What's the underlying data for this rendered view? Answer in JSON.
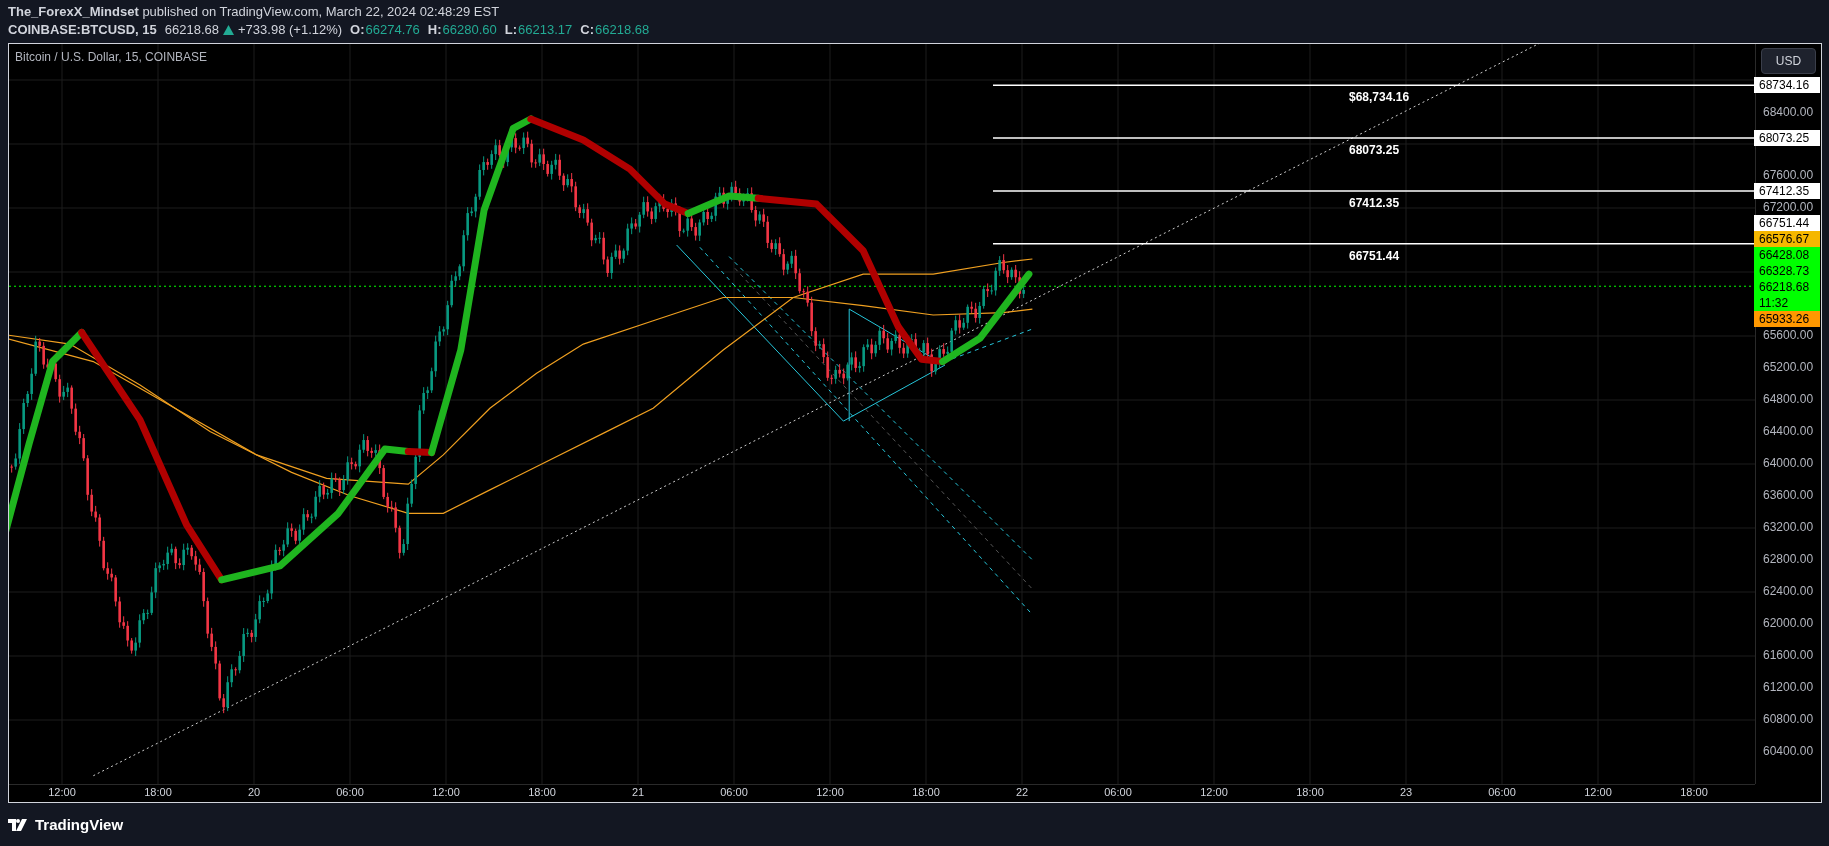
{
  "header": {
    "byline": "**The_ForexX_Mindset** published on TradingView.com, March 22, 2024 02:48:29 EST",
    "symbol": "COINBASE:BTCUSD, 15",
    "last": "66218.68",
    "change": "+733.98 (+1.12%)",
    "ohlc": [
      {
        "label": "O:",
        "value": "66274.76"
      },
      {
        "label": "H:",
        "value": "66280.60"
      },
      {
        "label": "L:",
        "value": "66213.17"
      },
      {
        "label": "C:",
        "value": "66218.68"
      }
    ]
  },
  "chart": {
    "title": "Bitcoin / U.S. Dollar, 15, COINBASE",
    "currency": "USD",
    "levels": [
      {
        "label": "$68,734.16"
      },
      {
        "label": "68073.25"
      },
      {
        "label": "67412.35"
      },
      {
        "label": "66751.44"
      }
    ],
    "price_ticks": [
      "68400.00",
      "67600.00",
      "67200.00",
      "65600.00",
      "65200.00",
      "64800.00",
      "64400.00",
      "64000.00",
      "63600.00",
      "63200.00",
      "62800.00",
      "62400.00",
      "62000.00",
      "61600.00",
      "61200.00",
      "60800.00",
      "60400.00"
    ],
    "badges": [
      {
        "value": "68734.16",
        "color": "#ffffff"
      },
      {
        "value": "68073.25",
        "color": "#ffffff"
      },
      {
        "value": "67412.35",
        "color": "#ffffff"
      },
      {
        "value": "66751.44",
        "color": "#ffffff"
      },
      {
        "value": "66576.67",
        "color": "#f5b700"
      },
      {
        "value": "66428.08",
        "color": "#00ff00"
      },
      {
        "value": "66328.73",
        "color": "#00ff00"
      },
      {
        "value": "66218.68",
        "color": "#00ff00",
        "countdown": "11:32"
      },
      {
        "value": "65933.26",
        "color": "#ff9800"
      }
    ],
    "time_ticks": [
      "12:00",
      "18:00",
      "20",
      "06:00",
      "12:00",
      "18:00",
      "21",
      "06:00",
      "12:00",
      "18:00",
      "22",
      "06:00",
      "12:00",
      "18:00",
      "23",
      "06:00",
      "12:00",
      "18:00"
    ]
  },
  "footer": {
    "brand": "TradingView"
  }
}
